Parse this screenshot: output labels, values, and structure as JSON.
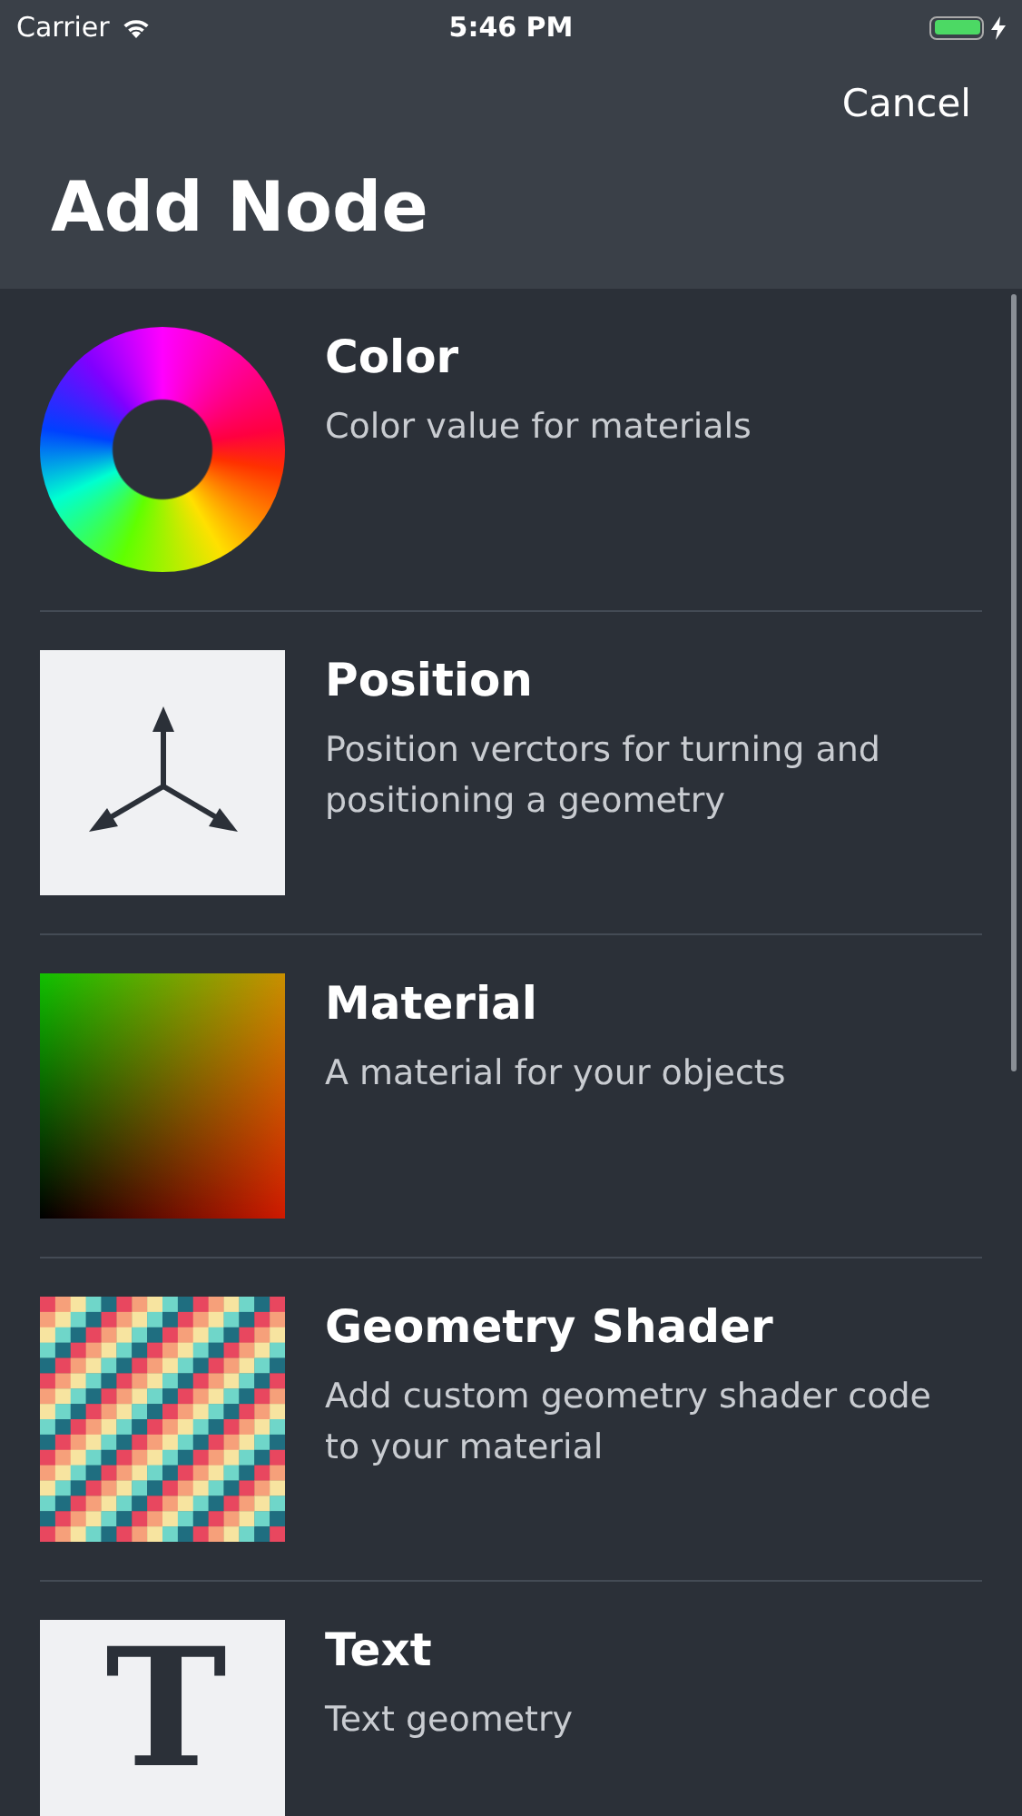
{
  "status_bar": {
    "carrier": "Carrier",
    "time": "5:46 PM"
  },
  "nav": {
    "cancel": "Cancel",
    "title": "Add Node"
  },
  "items": [
    {
      "kind": "color_wheel",
      "title": "Color",
      "subtitle": "Color value for materials"
    },
    {
      "kind": "axes",
      "title": "Position",
      "subtitle": "Position verctors for turning and positioning a geometry"
    },
    {
      "kind": "gradient",
      "title": "Material",
      "subtitle": "A material for your objects"
    },
    {
      "kind": "stripes",
      "title": "Geometry Shader",
      "subtitle": "Add custom geometry shader code to your material"
    },
    {
      "kind": "glyph",
      "title": "Text",
      "subtitle": "Text geometry",
      "glyph": "T"
    }
  ]
}
